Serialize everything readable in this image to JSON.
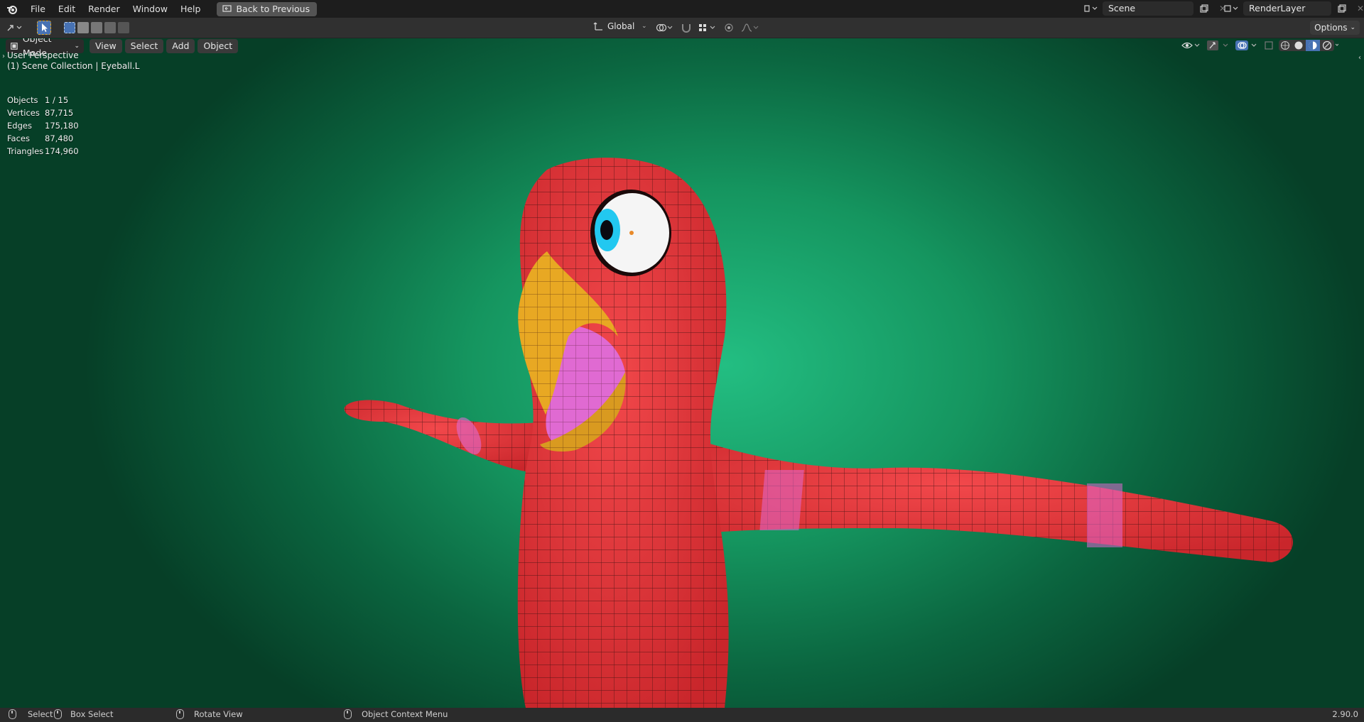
{
  "menu": {
    "items": [
      "File",
      "Edit",
      "Render",
      "Window",
      "Help"
    ],
    "back_label": "Back to Previous"
  },
  "scene": {
    "name": "Scene",
    "render_layer": "RenderLayer"
  },
  "toolbar": {
    "transform_orientation": "Global",
    "options_label": "Options"
  },
  "viewport_header": {
    "mode": "Object Mode",
    "menus": [
      "View",
      "Select",
      "Add",
      "Object"
    ]
  },
  "overlay": {
    "perspective": "User Perspective",
    "collection": "(1) Scene Collection | Eyeball.L",
    "stats": [
      {
        "label": "Objects",
        "value": "1 / 15"
      },
      {
        "label": "Vertices",
        "value": "87,715"
      },
      {
        "label": "Edges",
        "value": "175,180"
      },
      {
        "label": "Faces",
        "value": "87,480"
      },
      {
        "label": "Triangles",
        "value": "174,960"
      }
    ]
  },
  "status": {
    "select": "Select",
    "box_select": "Box Select",
    "rotate": "Rotate View",
    "context": "Object Context Menu",
    "version": "2.90.0"
  },
  "colors": {
    "body": "#e8393d",
    "beak": "#e8a823",
    "mouth": "#e06ad2",
    "bg_center": "#23be82",
    "bg_edge": "#063f27"
  }
}
